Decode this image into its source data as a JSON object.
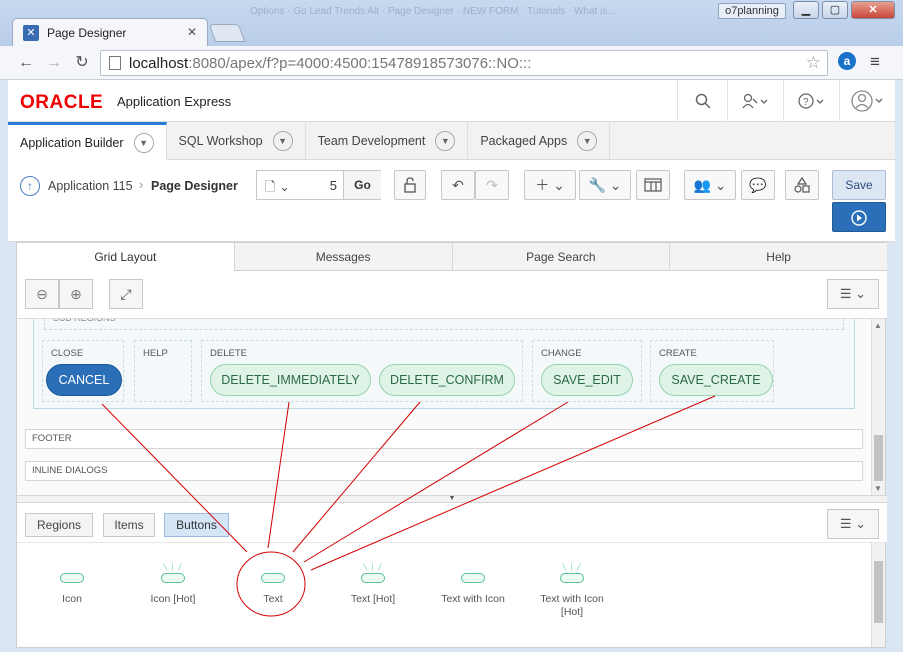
{
  "browser": {
    "tab_title": "Page Designer",
    "tab_close": "✕",
    "ghost_tabs": "Options  ·  Go Lead Trends Alt  ·  Page Designer  ·  NEW FORM  ·  Tutorials  ·  What is...",
    "profile": "o7planning",
    "url_host": "localhost",
    "url_rest": ":8080/apex/f?p=4000:4500:15478918573076::NO:::",
    "win_min": "▁",
    "win_max": "▢",
    "win_close": "✕",
    "back": "←",
    "forward": "→",
    "reload": "↻",
    "star": "☆",
    "ext_label": "a",
    "menu": "≡"
  },
  "header": {
    "logo": "ORACLE",
    "product": "Application Express",
    "icons": [
      "search-icon",
      "user-settings-icon",
      "help-icon",
      "account-icon"
    ]
  },
  "main_tabs": [
    {
      "label": "Application Builder"
    },
    {
      "label": "SQL Workshop"
    },
    {
      "label": "Team Development"
    },
    {
      "label": "Packaged Apps"
    }
  ],
  "toolbar": {
    "crumb_app": "Application 115",
    "crumb_sep": "›",
    "crumb_page": "Page Designer",
    "page_number": "5",
    "go_label": "Go",
    "save_label": "Save"
  },
  "content_tabs": [
    {
      "label": "Grid Layout"
    },
    {
      "label": "Messages"
    },
    {
      "label": "Page Search"
    },
    {
      "label": "Help"
    }
  ],
  "grid": {
    "sub_regions": "SUB REGIONS",
    "slots": {
      "close": "CLOSE",
      "help": "HELP",
      "delete": "DELETE",
      "change": "CHANGE",
      "create": "CREATE"
    },
    "buttons": {
      "cancel": "CANCEL",
      "delete_immediately": "DELETE_IMMEDIATELY",
      "delete_confirm": "DELETE_CONFIRM",
      "save_edit": "SAVE_EDIT",
      "save_create": "SAVE_CREATE"
    },
    "footer": "FOOTER",
    "inline_dialogs": "INLINE DIALOGS"
  },
  "gallery": {
    "tabs": [
      {
        "label": "Regions"
      },
      {
        "label": "Items"
      },
      {
        "label": "Buttons"
      }
    ],
    "items": [
      {
        "label": "Icon"
      },
      {
        "label": "Icon [Hot]"
      },
      {
        "label": "Text"
      },
      {
        "label": "Text [Hot]"
      },
      {
        "label": "Text with Icon"
      },
      {
        "label": "Text with Icon [Hot]"
      }
    ]
  },
  "colors": {
    "accent": "#2a6fb8",
    "button_green_fill": "#dff3e7",
    "button_green_border": "#96d3ac",
    "annotation": "#d40000",
    "oracle_red": "#ee0000"
  }
}
